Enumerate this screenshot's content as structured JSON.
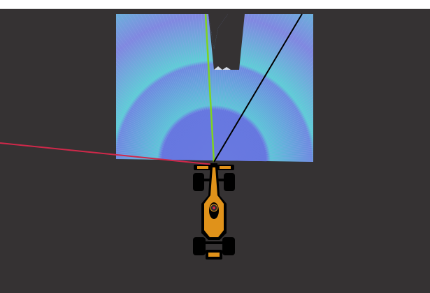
{
  "window": {
    "background": "#353233",
    "topbar_color": "#ffffff"
  },
  "lidar_scan": {
    "description_visible": "",
    "inner_color": "#6679e0",
    "outer_color": "#5ed0d8",
    "mid_color": "#8a8ee6"
  },
  "rays": [
    {
      "name": "steering-ray",
      "color": "#7ed321"
    },
    {
      "name": "heading-ray",
      "color": "#000000"
    },
    {
      "name": "lateral-ray",
      "color": "#d0284a"
    }
  ],
  "vehicle": {
    "icon": "race-car-icon",
    "body_color": "#e0921a",
    "tire_color": "#000000"
  }
}
